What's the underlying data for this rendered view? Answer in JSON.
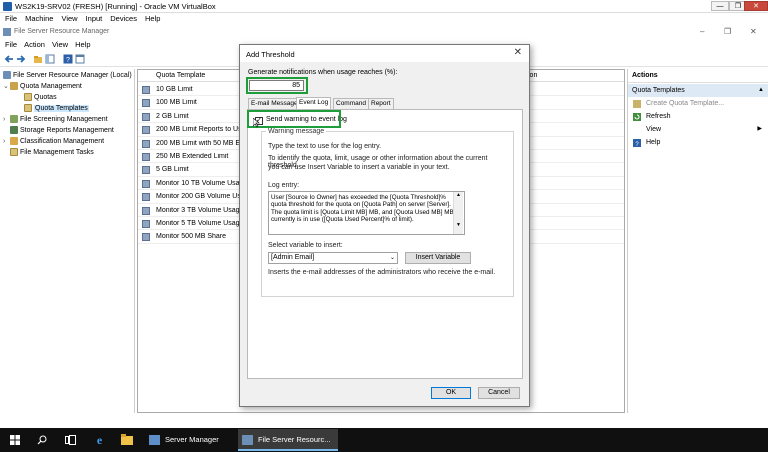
{
  "vbox": {
    "title": "WS2K19-SRV02 (FRESH) [Running] - Oracle VM VirtualBox",
    "menu": [
      "File",
      "Machine",
      "View",
      "Input",
      "Devices",
      "Help"
    ],
    "controls": {
      "minimize": "—",
      "restore": "❐",
      "close": "✕"
    }
  },
  "app": {
    "title": "File Server Resource Manager",
    "menu": [
      "File",
      "Action",
      "View",
      "Help"
    ],
    "window_controls": {
      "minimize": "–",
      "restore": "❐",
      "close": "✕"
    }
  },
  "tree": {
    "items": [
      {
        "label": "File Server Resource Manager (Local)",
        "level": 0,
        "toggle": ""
      },
      {
        "label": "Quota Management",
        "level": 1,
        "toggle": "⌄"
      },
      {
        "label": "Quotas",
        "level": 2,
        "toggle": ""
      },
      {
        "label": "Quota Templates",
        "level": 2,
        "toggle": "",
        "selected": true
      },
      {
        "label": "File Screening Management",
        "level": 1,
        "toggle": "›"
      },
      {
        "label": "Storage Reports Management",
        "level": 1,
        "toggle": ""
      },
      {
        "label": "Classification Management",
        "level": 1,
        "toggle": "›"
      },
      {
        "label": "File Management Tasks",
        "level": 1,
        "toggle": ""
      }
    ]
  },
  "list": {
    "columns": {
      "quota_template": "Quota Template",
      "description": "ion"
    },
    "rows": [
      "10 GB Limit",
      "100 MB Limit",
      "2 GB Limit",
      "200 MB Limit Reports to Us",
      "200 MB Limit with 50 MB E",
      "250 MB Extended Limit",
      "5 GB Limit",
      "Monitor 10 TB Volume Usag",
      "Monitor 200 GB Volume Usa",
      "Monitor 3 TB Volume Usage",
      "Monitor 5 TB Volume Usage",
      "Monitor 500 MB Share"
    ]
  },
  "actions": {
    "header": "Actions",
    "section": "Quota Templates",
    "items": [
      {
        "label": "Create Quota Template...",
        "icon": "create-template-icon",
        "disabled": true
      },
      {
        "label": "Refresh",
        "icon": "refresh-icon"
      },
      {
        "label": "View",
        "icon": "",
        "submenu": "▶"
      },
      {
        "label": "Help",
        "icon": "help-icon"
      }
    ],
    "section_toggle": "▲"
  },
  "dialog": {
    "title": "Add Threshold",
    "close": "✕",
    "generate_label": "Generate notifications when usage reaches (%):",
    "percent_value": "85",
    "tabs": [
      "E-mail Message",
      "Event Log",
      "Command",
      "Report"
    ],
    "active_tab": "Event Log",
    "checkbox_label": "Send warning to event log",
    "checkbox_checked": true,
    "group_label": "Warning message",
    "instruction_1": "Type the text to use for the log entry.",
    "instruction_2a": "To identify the quota, limit, usage or other information about the current threshold,",
    "instruction_2b": "you can use Insert Variable to insert a variable in your text.",
    "log_entry_label": "Log entry:",
    "log_entry_text": "User [Source Io Owner] has exceeded the [Quota Threshold]% quota threshold for the quota on [Quota Path] on server [Server]. The quota limit is [Quota Limit MB] MB, and [Quota Used MB] MB currently is in use ([Quota Used Percent]% of limit).",
    "select_label": "Select variable to insert:",
    "select_value": "[Admin Email]",
    "insert_button": "Insert Variable",
    "variable_desc": "Inserts the e-mail addresses of the administrators who receive the e-mail.",
    "ok": "OK",
    "cancel": "Cancel"
  },
  "taskbar": {
    "tasks": [
      {
        "label": "Server Manager",
        "active": false
      },
      {
        "label": "File Server Resourc...",
        "active": true
      }
    ]
  },
  "colors": {
    "highlight_box": "#1e9e3a",
    "selection": "#cce8ff",
    "accent": "#0078d7"
  }
}
